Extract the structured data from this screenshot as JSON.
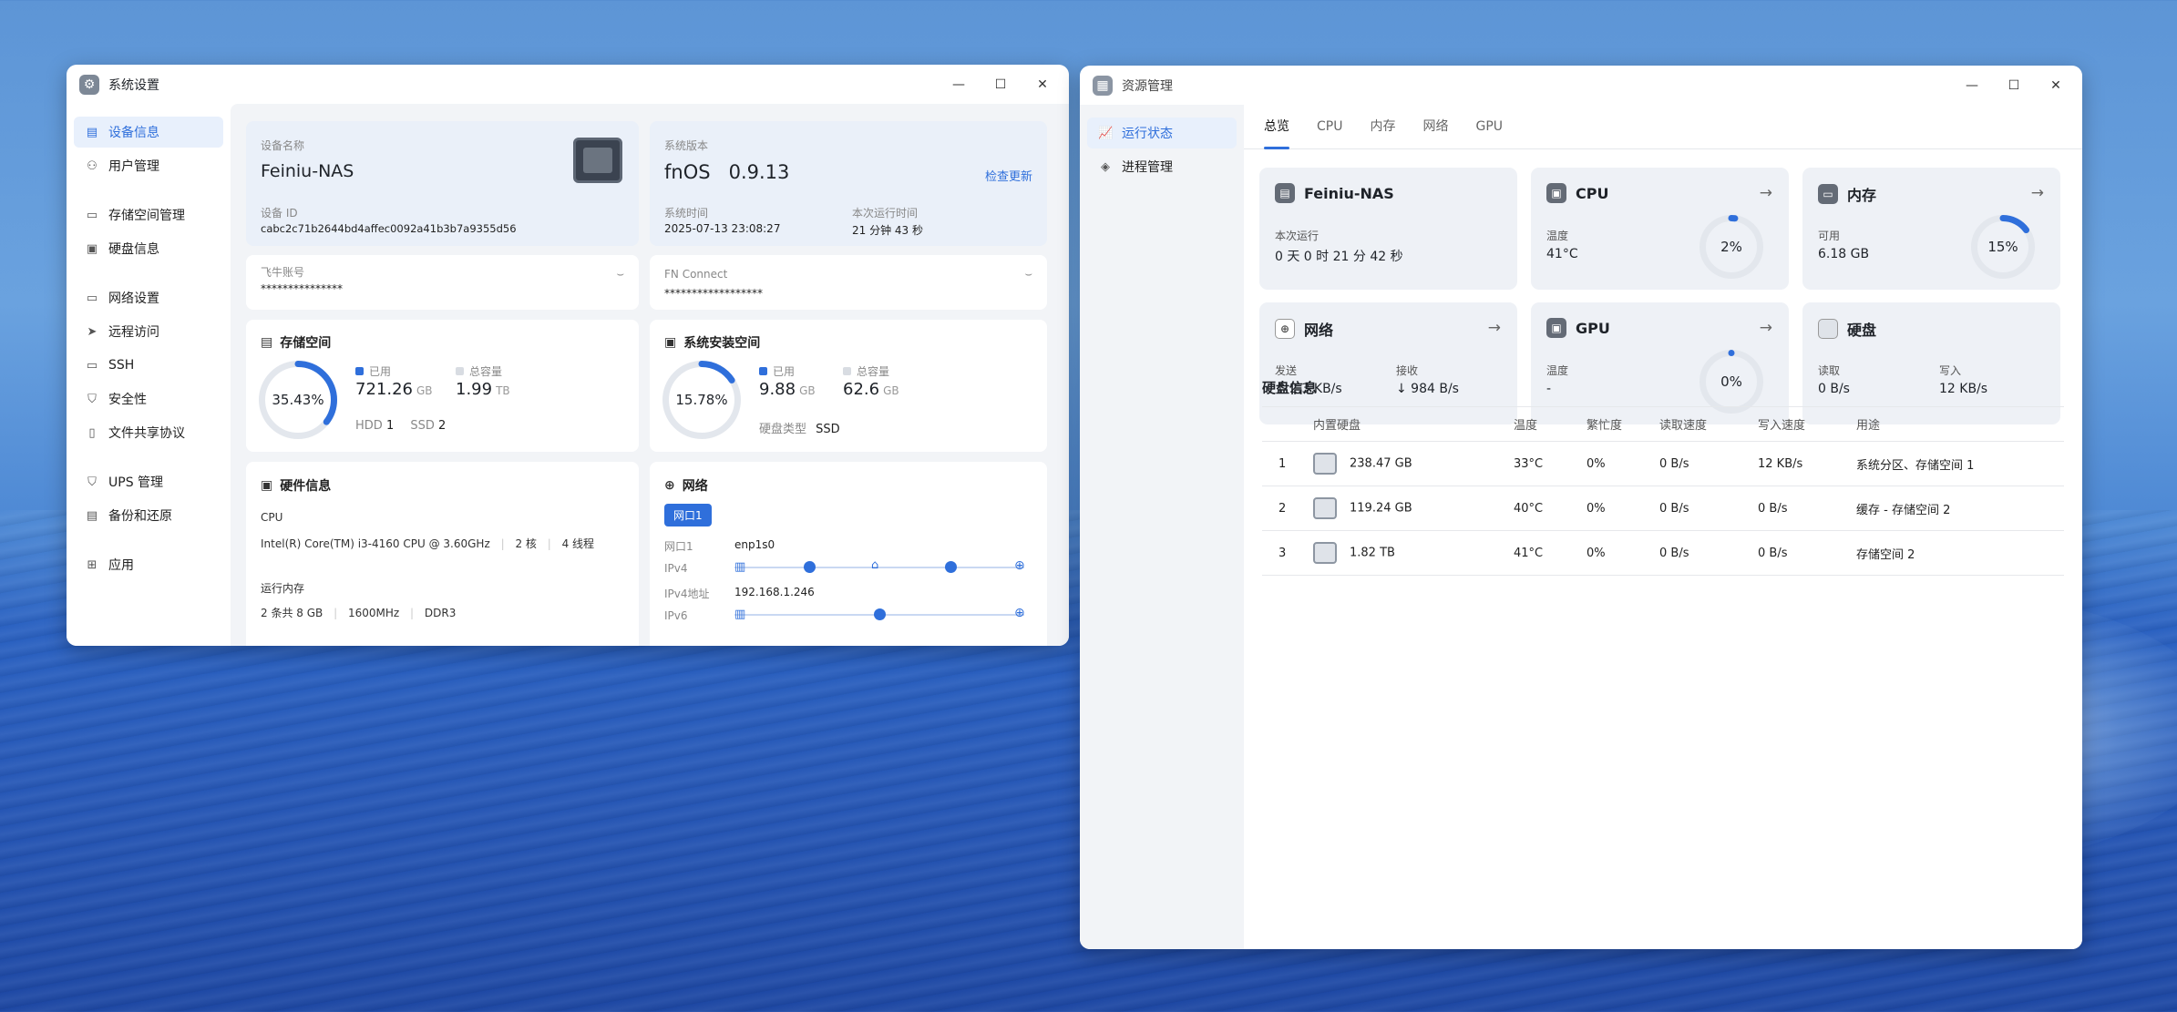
{
  "sys_window": {
    "title": "系统设置",
    "controls": [
      "—",
      "☐",
      "✕"
    ],
    "sidebar": [
      {
        "label": "设备信息",
        "icon": "monitor-icon",
        "glyph": "▤",
        "active": true
      },
      {
        "label": "用户管理",
        "icon": "user-icon",
        "glyph": "⚇"
      },
      {
        "label": "存储空间管理",
        "icon": "storage-icon",
        "glyph": "▭",
        "group_gap": true
      },
      {
        "label": "硬盘信息",
        "icon": "disk-icon",
        "glyph": "▣"
      },
      {
        "label": "网络设置",
        "icon": "network-icon",
        "glyph": "▭",
        "group_gap": true
      },
      {
        "label": "远程访问",
        "icon": "send-icon",
        "glyph": "➤"
      },
      {
        "label": "SSH",
        "icon": "terminal-icon",
        "glyph": "▭"
      },
      {
        "label": "安全性",
        "icon": "shield-icon",
        "glyph": "⛉"
      },
      {
        "label": "文件共享协议",
        "icon": "file-icon",
        "glyph": "▯"
      },
      {
        "label": "UPS 管理",
        "icon": "ups-icon",
        "glyph": "⛉",
        "group_gap": true
      },
      {
        "label": "备份和还原",
        "icon": "backup-icon",
        "glyph": "▤"
      },
      {
        "label": "应用",
        "icon": "apps-icon",
        "glyph": "⊞",
        "group_gap": true
      }
    ],
    "device": {
      "name_label": "设备名称",
      "name": "Feiniu-NAS",
      "id_label": "设备 ID",
      "id": "cabc2c71b2644bd4affec0092a41b3b7a9355d56"
    },
    "system": {
      "version_label": "系统版本",
      "version": "fnOS   0.9.13",
      "check_update": "检查更新",
      "time_label": "系统时间",
      "time": "2025-07-13 23:08:27",
      "uptime_label": "本次运行时间",
      "uptime": "21 分钟 43 秒"
    },
    "account": {
      "label": "飞牛账号",
      "value": "***************"
    },
    "connect": {
      "label": "FN Connect",
      "value": "******************"
    },
    "storage": {
      "title": "存储空间",
      "percent": "35.43%",
      "percent_value": 35.43,
      "used_label": "已用",
      "used": "721.26",
      "used_unit": "GB",
      "total_label": "总容量",
      "total": "1.99",
      "total_unit": "TB",
      "hdd_label": "HDD",
      "hdd": "1",
      "ssd_label": "SSD",
      "ssd": "2"
    },
    "sysdisk": {
      "title": "系统安装空间",
      "percent": "15.78%",
      "percent_value": 15.78,
      "used_label": "已用",
      "used": "9.88",
      "used_unit": "GB",
      "total_label": "总容量",
      "total": "62.6",
      "total_unit": "GB",
      "type_label": "硬盘类型",
      "type": "SSD"
    },
    "hardware": {
      "title": "硬件信息",
      "cpu_label": "CPU",
      "cpu": "Intel(R) Core(TM) i3-4160 CPU @ 3.60GHz",
      "cores": "2 核",
      "threads": "4 线程",
      "mem_label": "运行内存",
      "mem": "2 条共 8 GB",
      "mem_speed": "1600MHz",
      "mem_type": "DDR3"
    },
    "network": {
      "title": "网络",
      "port_tab": "网口1",
      "port_label": "网口1",
      "port": "enp1s0",
      "ipv4_label": "IPv4",
      "ipv4_addr_label": "IPv4地址",
      "ipv4_addr": "192.168.1.246",
      "ipv6_label": "IPv6"
    }
  },
  "res_window": {
    "title": "资源管理",
    "controls": [
      "—",
      "☐",
      "✕"
    ],
    "sidebar": [
      {
        "label": "运行状态",
        "icon": "chart-icon",
        "glyph": "📈",
        "active": true
      },
      {
        "label": "进程管理",
        "icon": "layers-icon",
        "glyph": "◈"
      }
    ],
    "tabs": [
      {
        "label": "总览",
        "active": true
      },
      {
        "label": "CPU"
      },
      {
        "label": "内存"
      },
      {
        "label": "网络"
      },
      {
        "label": "GPU"
      }
    ],
    "host": {
      "name": "Feiniu-NAS",
      "uptime_label": "本次运行",
      "uptime": "0 天 0 时 21 分 42 秒"
    },
    "cpu": {
      "title": "CPU",
      "temp_label": "温度",
      "temp": "41°C",
      "usage": "2%",
      "usage_value": 2
    },
    "memory": {
      "title": "内存",
      "avail_label": "可用",
      "avail": "6.18 GB",
      "usage": "15%",
      "usage_value": 15
    },
    "net": {
      "title": "网络",
      "send_label": "发送",
      "send": "↑ 2.3 KB/s",
      "recv_label": "接收",
      "recv": "↓ 984 B/s"
    },
    "gpu": {
      "title": "GPU",
      "temp_label": "温度",
      "temp": "-",
      "usage": "0%",
      "usage_value": 0
    },
    "disk": {
      "title": "硬盘",
      "read_label": "读取",
      "read": "0 B/s",
      "write_label": "写入",
      "write": "12 KB/s"
    },
    "disk_info": {
      "title": "硬盘信息",
      "columns": [
        "内置硬盘",
        "温度",
        "繁忙度",
        "读取速度",
        "写入速度",
        "用途"
      ],
      "rows": [
        {
          "idx": "1",
          "size": "238.47 GB",
          "temp": "33°C",
          "busy": "0%",
          "read": "0 B/s",
          "write": "12 KB/s",
          "use": "系统分区、存储空间 1"
        },
        {
          "idx": "2",
          "size": "119.24 GB",
          "temp": "40°C",
          "busy": "0%",
          "read": "0 B/s",
          "write": "0 B/s",
          "use": "缓存 - 存储空间 2"
        },
        {
          "idx": "3",
          "size": "1.82 TB",
          "temp": "41°C",
          "busy": "0%",
          "read": "0 B/s",
          "write": "0 B/s",
          "use": "存储空间 2"
        }
      ]
    }
  },
  "colors": {
    "accent": "#2f6fdb",
    "ring_track": "#e3e7ed"
  }
}
